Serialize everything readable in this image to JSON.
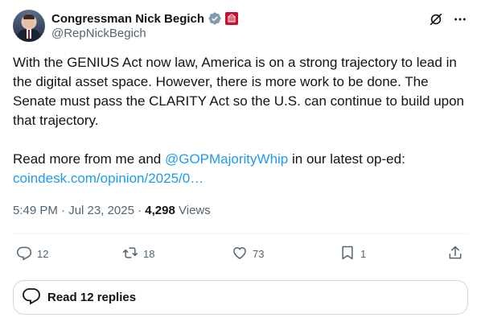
{
  "author": {
    "display_name": "Congressman Nick Begich",
    "handle": "@RepNickBegich"
  },
  "tweet": {
    "text_main": "With the GENIUS Act now law, America is on a strong trajectory to lead in the digital asset space. However, there is more work to be done. The Senate must pass the CLARITY Act so the U.S. can continue to build upon that trajectory.",
    "text_read_more": "Read more from me and ",
    "mention": "@GOPMajorityWhip",
    "text_after_mention": " in our latest op-ed:",
    "link": "coindesk.com/opinion/2025/0…"
  },
  "meta": {
    "time": "5:49 PM",
    "separator": " · ",
    "date": "Jul 23, 2025",
    "views_count": "4,298",
    "views_label": " Views"
  },
  "actions": {
    "replies": "12",
    "reposts": "18",
    "likes": "73",
    "bookmarks": "1"
  },
  "read_replies_label": "Read 12 replies",
  "icons": {
    "verified": "verified-badge-icon",
    "house_seal": "house-seal-icon",
    "grok": "grok-icon",
    "more": "more-icon",
    "reply": "reply-icon",
    "repost": "repost-icon",
    "like": "like-icon",
    "bookmark": "bookmark-icon",
    "share": "share-icon"
  },
  "colors": {
    "link": "#1d9bf0",
    "secondary_text": "#536471",
    "verified": "#829aab"
  }
}
